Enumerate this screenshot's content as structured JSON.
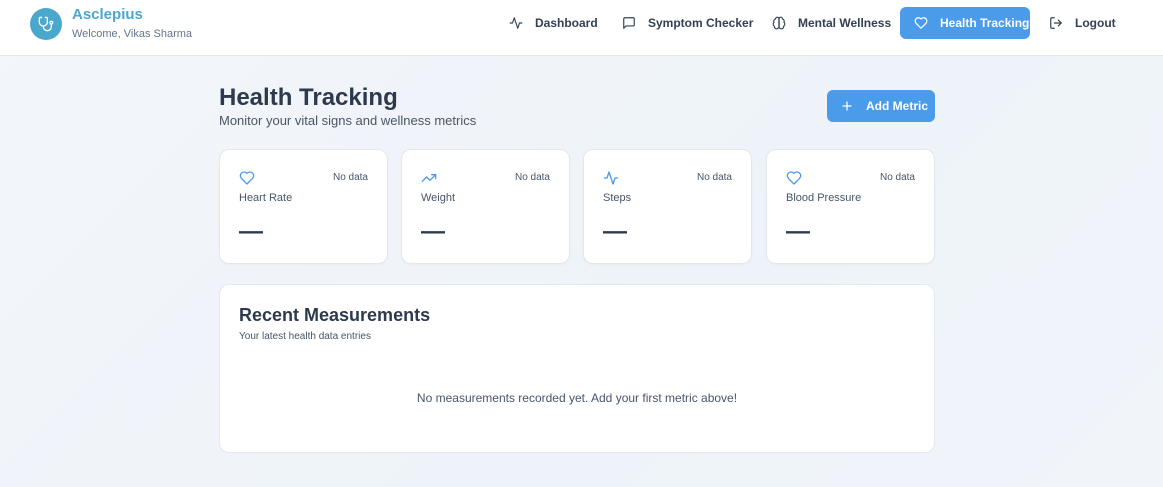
{
  "brand": {
    "name": "Asclepius",
    "welcome": "Welcome, Vikas Sharma",
    "logo_icon": "stethoscope-icon",
    "color": "#4aa8cc"
  },
  "nav": {
    "items": [
      {
        "label": "Dashboard",
        "icon": "activity-icon",
        "active": false
      },
      {
        "label": "Symptom Checker",
        "icon": "message-square-icon",
        "active": false
      },
      {
        "label": "Mental Wellness",
        "icon": "brain-icon",
        "active": false
      },
      {
        "label": "Health Tracking",
        "icon": "heart-icon",
        "active": true
      },
      {
        "label": "Logout",
        "icon": "logout-icon",
        "active": false
      }
    ],
    "accent": "#4a9bea"
  },
  "page": {
    "title": "Health Tracking",
    "subtitle": "Monitor your vital signs and wellness metrics",
    "add_button": {
      "label": "Add Metric",
      "icon": "plus-icon"
    }
  },
  "metrics": [
    {
      "label": "Heart Rate",
      "status": "No data",
      "value": "—",
      "icon": "heart-icon"
    },
    {
      "label": "Weight",
      "status": "No data",
      "value": "—",
      "icon": "trending-up-icon"
    },
    {
      "label": "Steps",
      "status": "No data",
      "value": "—",
      "icon": "activity-icon"
    },
    {
      "label": "Blood Pressure",
      "status": "No data",
      "value": "—",
      "icon": "heart-icon"
    }
  ],
  "recent": {
    "title": "Recent Measurements",
    "subtitle": "Your latest health data entries",
    "empty_message": "No measurements recorded yet. Add your first metric above!"
  }
}
